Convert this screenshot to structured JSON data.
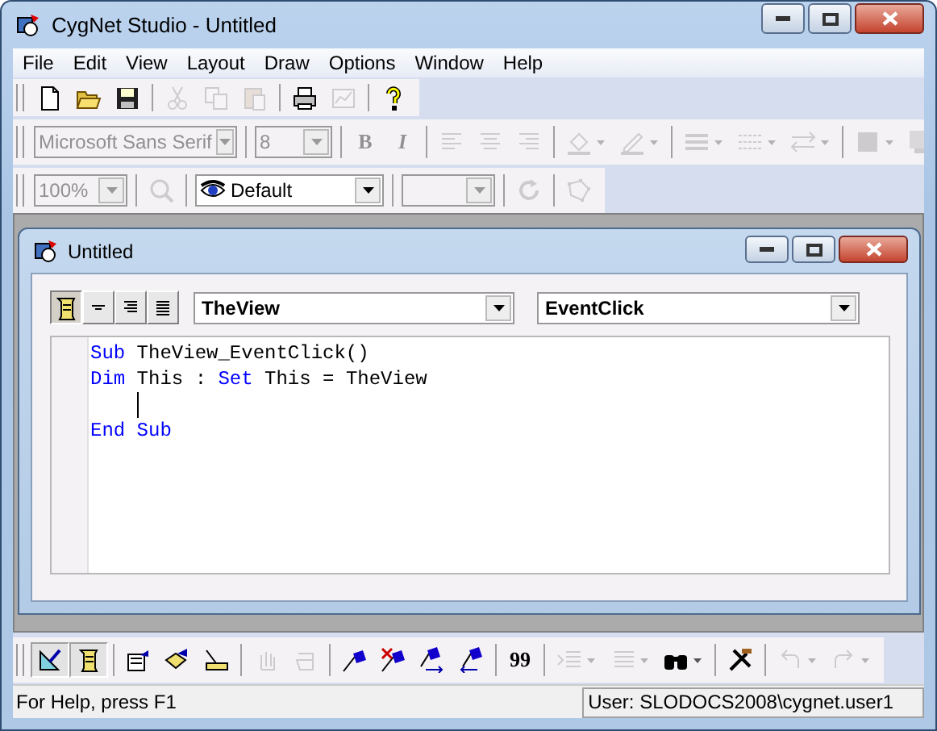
{
  "window": {
    "title": "CygNet Studio - Untitled"
  },
  "menu": [
    "File",
    "Edit",
    "View",
    "Layout",
    "Draw",
    "Options",
    "Window",
    "Help"
  ],
  "toolbars": [
    {
      "items": [
        {
          "kind": "button",
          "disabled": false
        },
        {
          "kind": "button",
          "disabled": false
        },
        {
          "kind": "button",
          "disabled": false
        },
        {
          "kind": "separator"
        },
        {
          "kind": "button",
          "disabled": true
        },
        {
          "kind": "button",
          "disabled": true
        },
        {
          "kind": "button",
          "disabled": true
        },
        {
          "kind": "separator"
        },
        {
          "kind": "button",
          "disabled": false
        },
        {
          "kind": "button",
          "disabled": true
        },
        {
          "kind": "separator"
        },
        {
          "kind": "button",
          "disabled": false
        }
      ]
    },
    {
      "items": [
        {
          "kind": "combo",
          "value": "Microsoft Sans Serif",
          "disabled": true
        },
        {
          "kind": "separator"
        },
        {
          "kind": "combo",
          "value": "8",
          "disabled": true
        },
        {
          "kind": "separator"
        },
        {
          "kind": "text-button",
          "label": "B",
          "disabled": true
        },
        {
          "kind": "text-button",
          "label": "I",
          "disabled": true
        },
        {
          "kind": "separator"
        },
        {
          "kind": "button",
          "disabled": true
        },
        {
          "kind": "button",
          "disabled": true
        },
        {
          "kind": "button",
          "disabled": true
        },
        {
          "kind": "separator"
        },
        {
          "kind": "dropdown",
          "disabled": true
        },
        {
          "kind": "dropdown",
          "disabled": true
        },
        {
          "kind": "separator"
        },
        {
          "kind": "dropdown",
          "disabled": true
        },
        {
          "kind": "dropdown",
          "disabled": true
        },
        {
          "kind": "dropdown",
          "disabled": true
        },
        {
          "kind": "separator"
        },
        {
          "kind": "dropdown",
          "disabled": true
        },
        {
          "kind": "dropdown",
          "disabled": true
        }
      ]
    },
    {
      "items": [
        {
          "kind": "combo",
          "value": "100%",
          "disabled": true
        },
        {
          "kind": "separator"
        },
        {
          "kind": "button",
          "disabled": true
        },
        {
          "kind": "separator"
        },
        {
          "kind": "combo",
          "value": "Default",
          "disabled": false
        },
        {
          "kind": "separator"
        },
        {
          "kind": "combo",
          "disabled": true
        },
        {
          "kind": "separator"
        },
        {
          "kind": "button",
          "disabled": true
        },
        {
          "kind": "separator"
        },
        {
          "kind": "button",
          "disabled": true
        }
      ]
    }
  ],
  "child_window": {
    "title": "Untitled",
    "buttons": [
      {
        "selected": true
      },
      {
        "selected": false
      },
      {
        "selected": false
      },
      {
        "selected": false
      }
    ],
    "object_combo": {
      "value": "TheView"
    },
    "event_combo": {
      "value": "EventClick"
    },
    "code_lines": [
      {
        "tokens": [
          {
            "kind": "keyword",
            "text": "Sub"
          },
          {
            "kind": "plain",
            "text": " TheView_EventClick()"
          }
        ],
        "caret": false
      },
      {
        "tokens": [
          {
            "kind": "keyword",
            "text": "Dim"
          },
          {
            "kind": "plain",
            "text": " This : "
          },
          {
            "kind": "keyword",
            "text": "Set"
          },
          {
            "kind": "plain",
            "text": " This = TheView"
          }
        ],
        "caret": false
      },
      {
        "caret": true
      },
      {
        "tokens": [
          {
            "kind": "keyword",
            "text": "End Sub"
          }
        ],
        "caret": false
      }
    ]
  },
  "bottom_toolbar": {
    "items": [
      {
        "kind": "button",
        "disabled": false,
        "selected": true
      },
      {
        "kind": "button",
        "disabled": false,
        "selected": true
      },
      {
        "kind": "separator"
      },
      {
        "kind": "button",
        "disabled": false,
        "selected": false
      },
      {
        "kind": "button",
        "disabled": false,
        "selected": false
      },
      {
        "kind": "button",
        "disabled": false,
        "selected": false
      },
      {
        "kind": "separator"
      },
      {
        "kind": "button",
        "disabled": true,
        "selected": false
      },
      {
        "kind": "button",
        "disabled": true,
        "selected": false
      },
      {
        "kind": "separator"
      },
      {
        "kind": "button",
        "disabled": false,
        "selected": false
      },
      {
        "kind": "button",
        "disabled": false,
        "selected": false
      },
      {
        "kind": "button",
        "disabled": false,
        "selected": false
      },
      {
        "kind": "button",
        "disabled": false,
        "selected": false
      },
      {
        "kind": "separator"
      },
      {
        "kind": "text-button",
        "label": "99",
        "disabled": false,
        "selected": false
      },
      {
        "kind": "separator"
      },
      {
        "kind": "dropdown",
        "disabled": true,
        "selected": false
      },
      {
        "kind": "dropdown",
        "disabled": true,
        "selected": false
      },
      {
        "kind": "dropdown",
        "disabled": false,
        "selected": false
      },
      {
        "kind": "separator"
      },
      {
        "kind": "button",
        "disabled": false,
        "selected": false
      },
      {
        "kind": "separator"
      },
      {
        "kind": "dropdown",
        "disabled": true,
        "selected": false
      },
      {
        "kind": "dropdown",
        "disabled": true,
        "selected": false
      }
    ]
  },
  "status_bar": {
    "help": "For Help, press F1",
    "user": "User: SLODOCS2008\\cygnet.user1"
  }
}
